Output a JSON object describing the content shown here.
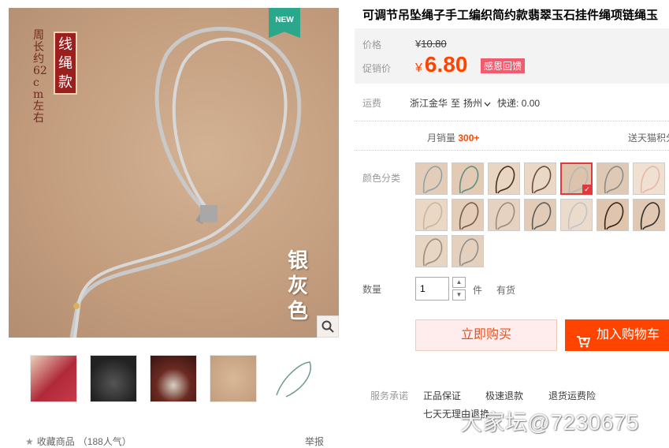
{
  "product": {
    "title": "可调节吊坠绳子手工编织简约款翡翠玉石挂件绳项链绳玉",
    "image_texts": {
      "badge": "NEW",
      "vertical_note": "周长约62cm左右",
      "seal": "线绳款",
      "color_name": "银灰色"
    }
  },
  "price": {
    "label": "价格",
    "currency": "¥",
    "original": "10.80",
    "promo_label": "促销价",
    "promo": "6.80",
    "promo_tag": "感恩回馈"
  },
  "shipping": {
    "label": "运费",
    "from": "浙江金华",
    "to_word": "至",
    "to": "扬州",
    "method": "快递: 0.00"
  },
  "sales": {
    "label": "月销量",
    "count": "300+",
    "points": "送天猫积分"
  },
  "colors": {
    "label": "颜色分类",
    "swatches": [
      {
        "cord": "#8fa3a3",
        "bg": "#e4cdb8"
      },
      {
        "cord": "#5f8e86",
        "bg": "#e2cab4"
      },
      {
        "cord": "#4a2e22",
        "bg": "#e8d5c2"
      },
      {
        "cord": "#6b4a3a",
        "bg": "#ead8c6"
      },
      {
        "cord": "#b7b7b7",
        "bg": "#dcc3ab",
        "selected": true
      },
      {
        "cord": "#8a8a8a",
        "bg": "#e0c9b4"
      },
      {
        "cord": "#e9b5a4",
        "bg": "#f0e0d2"
      },
      {
        "cord": "#c9b79c",
        "bg": "#ead7c5"
      },
      {
        "cord": "#7a5a46",
        "bg": "#e3cdb9"
      },
      {
        "cord": "#9c8c7c",
        "bg": "#e6d2c0"
      },
      {
        "cord": "#5a5a5a",
        "bg": "#e2ccb7"
      },
      {
        "cord": "#c4c4c4",
        "bg": "#eadbcc"
      },
      {
        "cord": "#3a2418",
        "bg": "#dfc5ae"
      },
      {
        "cord": "#2f2f2f",
        "bg": "#e0c8b2"
      },
      {
        "cord": "#a08c78",
        "bg": "#e8d6c4"
      },
      {
        "cord": "#8e8e8e",
        "bg": "#e4d0bd"
      }
    ]
  },
  "quantity": {
    "label": "数量",
    "value": "1",
    "unit": "件",
    "stock": "有货"
  },
  "actions": {
    "buy": "立即购买",
    "cart": "加入购物车"
  },
  "services": {
    "label": "服务承诺",
    "items": [
      "正品保证",
      "极速退款",
      "退货运费险",
      "七天无理由退换"
    ]
  },
  "footer": {
    "favorite": "收藏商品",
    "popularity": "（188人气）",
    "report": "举报"
  },
  "watermark": "大家坛@7230675"
}
